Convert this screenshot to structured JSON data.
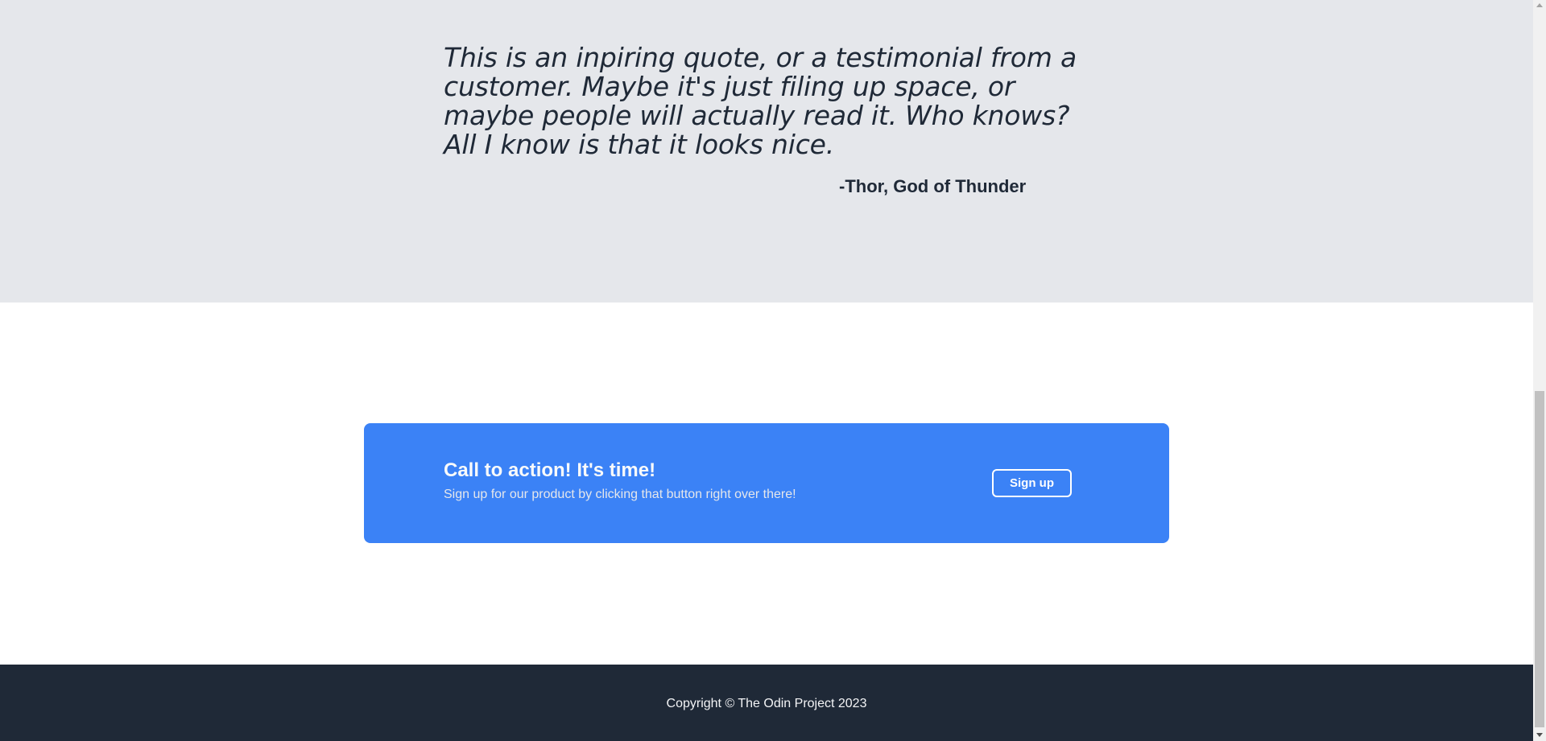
{
  "quote": {
    "text": "This is an inpiring quote, or a testimonial from a customer. Maybe it's just filing up space, or maybe people will actually read it. Who knows? All I know is that it looks nice.",
    "author": "-Thor, God of Thunder"
  },
  "cta": {
    "title": "Call to action! It's time!",
    "subtitle": "Sign up for our product by clicking that button right over there!",
    "button_label": "Sign up"
  },
  "footer": {
    "copyright": "Copyright © The Odin Project 2023"
  },
  "colors": {
    "quote_background": "#e5e7eb",
    "cta_background": "#3b82f6",
    "footer_background": "#1f2937",
    "text_dark": "#1f2937"
  },
  "icons": {
    "scroll_up": "chevron-up-icon",
    "scroll_down": "chevron-down-icon"
  }
}
